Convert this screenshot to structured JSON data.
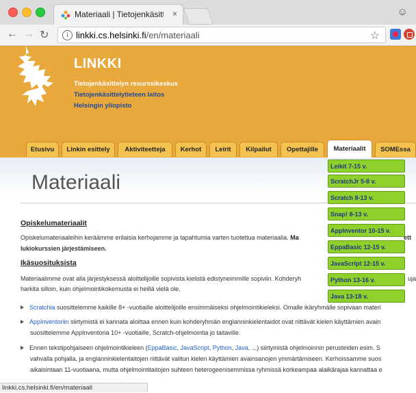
{
  "browser": {
    "tab_title": "Materiaali | Tietojenkäsittelyn r",
    "tab_close": "×",
    "url_host": "linkki.cs.helsinki.fi",
    "url_path": "/en/materiaali",
    "status_url": "linkki.cs.helsinki.fi/en/materiaali"
  },
  "site": {
    "title": "LINKKI",
    "subtitle_1": "Tietojenkäsittelyn resurssikeskus",
    "subtitle_2": "Tietojenkäsittelytieteen laitos",
    "subtitle_3": "Helsingin yliopisto",
    "accent_color": "#e9a83b"
  },
  "nav": {
    "tabs": [
      {
        "label": "Etusivu"
      },
      {
        "label": "Linkin esittely"
      },
      {
        "label": "Aktiviteetteja"
      },
      {
        "label": "Kerhot"
      },
      {
        "label": "Leirit"
      },
      {
        "label": "Kilpailut"
      },
      {
        "label": "Opettajille"
      },
      {
        "label": "Materiaalit"
      },
      {
        "label": "SOMEssa"
      }
    ],
    "active": "Materiaalit"
  },
  "dropdown": {
    "items": [
      {
        "label": "Leikit 7-15 v."
      },
      {
        "label": "ScratchJr 5-8 v."
      },
      {
        "label": "Scratch 8-13 v."
      },
      {
        "label": "Snap! 8-13 v."
      },
      {
        "label": "AppInventor 10-15 v."
      },
      {
        "label": "EppaBasic 12-15 v."
      },
      {
        "label": "JavaScript 12-15 v."
      },
      {
        "label": "Python 13-16 v."
      },
      {
        "label": "Java 13-18 v."
      }
    ]
  },
  "main": {
    "page_title": "Materiaali",
    "section_1_heading": "Opiskelumateriaalit",
    "section_1_text_a": "Opiskelumateriaaleihin keräämme erilaisia kerhojamme ja tapahtumia varten tuotettua materiaalia. ",
    "section_1_text_bold": "Ma",
    "section_1_text_tail": "ett",
    "section_1_line2": "lukiokurssien järjestämiseen.",
    "section_2_heading": "Ikäsuosituksista",
    "section_2_line1": "Materiaalimme ovat alla järjestyksessä aloittelijoille sopivista kielistä edistyneimmille sopiviin. Kohderyh",
    "section_2_line1_tail": "uja",
    "section_2_line2": "harkita silloin, kuin ohjelmointikokemusta ei heillä vielä ole.",
    "bullet_1_link": "Scratchia",
    "bullet_1_text": " suosittelemme kaikille 8+ -vuotiaille aloittelijoille ensimmäiseksi ohjelmointikieleksi. Omalle ikäryhmälle sopivaan materi",
    "bullet_2_link": "AppInventoriin",
    "bullet_2_text": " siirtymistä ei kannata aloittaa ennen kuin kohderyhmän englanninkielentaidot ovat riittävät kielen käyttämien avain",
    "bullet_2_line2": "suosittelemme AppInventoria 10+ -vuotiaille, Scratch-ohjelmointia jo taitaville.",
    "bullet_3_pre": "Ennen tekstipohjaiseen ohjelmointikieleen (",
    "bullet_3_link1": "EppaBasic",
    "bullet_3_sep1": ", ",
    "bullet_3_link2": "JavaScript",
    "bullet_3_sep2": ", ",
    "bullet_3_link3": "Python",
    "bullet_3_sep3": ", ",
    "bullet_3_link4": "Java",
    "bullet_3_post": ", ...) siirtymistä ohjelmoinnin perusteiden esim. S",
    "bullet_3_line2": "vahvalla pohjalla, ja englanninkielentaitojen riittävät valitun kielen käyttämien avainsanojen ymmärtämiseen. Kerhoissamme suos",
    "bullet_3_line3": "aikaisintaan 11-vuotiaana, mutta ohjelmointitaitojen suhteen heterogeenisemmissa ryhmissä korkeampaa alaikärajaa kannattaa e"
  }
}
